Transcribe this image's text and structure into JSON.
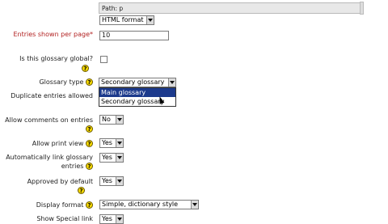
{
  "editor": {
    "path_text": "Path: p",
    "format_value": "HTML format"
  },
  "entries_per_page": {
    "label": "Entries shown per page*",
    "value": "10"
  },
  "global": {
    "label": "Is this glossary global?"
  },
  "glossary_type": {
    "label": "Glossary type",
    "value": "Secondary glossary",
    "options": [
      "Main glossary",
      "Secondary glossary"
    ]
  },
  "duplicate_entries": {
    "label": "Duplicate entries allowed"
  },
  "allow_comments": {
    "label": "Allow comments on entries",
    "value": "No"
  },
  "allow_print": {
    "label": "Allow print view",
    "value": "Yes"
  },
  "auto_link": {
    "label": "Automatically link glossary entries",
    "value": "Yes"
  },
  "approved_default": {
    "label": "Approved by default",
    "value": "Yes"
  },
  "display_format": {
    "label": "Display format",
    "value": "Simple, dictionary style"
  },
  "show_special": {
    "label": "Show Special link",
    "value": "Yes"
  }
}
